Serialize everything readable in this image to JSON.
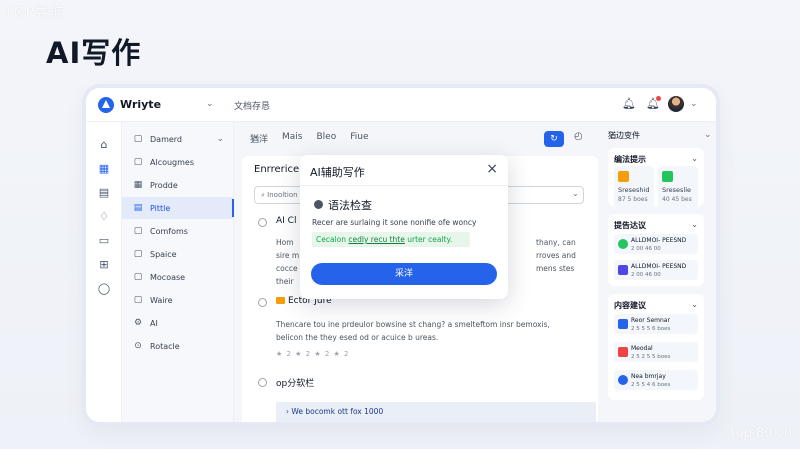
{
  "watermarks": {
    "top_left": "TOP导航",
    "bottom_right": "top 80.cn"
  },
  "hero_title": "AI写作",
  "app": {
    "name": "Wriyte",
    "doc_title": "文档存恳"
  },
  "icon_sidebar": [
    "home-icon",
    "grid-icon",
    "calendar-icon",
    "bell-icon",
    "chat-icon",
    "apps-icon",
    "user-icon"
  ],
  "nav": {
    "items": [
      {
        "icon": "▢",
        "label": "Damerd",
        "chevron": "⌄"
      },
      {
        "icon": "▢",
        "label": "Alcougmes"
      },
      {
        "icon": "▦",
        "label": "Prodde"
      },
      {
        "icon": "▤",
        "label": "Pittle",
        "active": true
      },
      {
        "icon": "▢",
        "label": "Comfoms"
      },
      {
        "icon": "▢",
        "label": "Spaice"
      },
      {
        "icon": "▢",
        "label": "Mocoase"
      },
      {
        "icon": "▢",
        "label": "Waire"
      },
      {
        "icon": "⚙",
        "label": "AI"
      },
      {
        "icon": "⊙",
        "label": "Rotacle"
      }
    ]
  },
  "editor": {
    "tabs": [
      "猶洋",
      "Mais",
      "Bleo",
      "Fiue"
    ],
    "heading": "Enrrerice",
    "search_placeholder": "Inooltion",
    "options": [
      {
        "title": "AI Cl",
        "lines": [
          "Hom",
          "sire m",
          "cocce",
          "their"
        ],
        "right_lines": [
          "thany, can",
          "rroves and",
          "mens stes"
        ]
      },
      {
        "title": "Ector Jure",
        "lines": [
          "Thencare tou ine prdeulor bowsine st chang? a smelteftom insr bemoxis,",
          "belicon the they esed od or acuice b ureas."
        ],
        "stars": "★ 2 ★ 2 ★ 2 ★ 2"
      },
      {
        "title": "op分软栏"
      }
    ],
    "bottom_box": "We bocomk ott fox 1000"
  },
  "right_panel": {
    "title": "猶边变件",
    "section1": {
      "title": "编法提示",
      "tiles": [
        {
          "label": "Sreseshid",
          "sub": "87 5 boes",
          "color": "#f59e0b"
        },
        {
          "label": "Sreseslie",
          "sub": "40 45 bes",
          "color": "#22c55e"
        }
      ]
    },
    "section2": {
      "title": "提告达议",
      "items": [
        {
          "title": "ALLDMOI- PEESND",
          "sub": "2 00 46 00",
          "color": "#22c55e"
        },
        {
          "title": "ALLDMOI- PEESND",
          "sub": "2 00 46 00",
          "color": "#4f46e5"
        }
      ]
    },
    "section3": {
      "title": "内容建议",
      "items": [
        {
          "title": "Reor Semnar",
          "sub": "2 5 5 5 6 boes",
          "color": "#2563eb"
        },
        {
          "title": "Meodal",
          "sub": "2 5 2 5 5 boes",
          "color": "#ef4444"
        },
        {
          "title": "Nea bmrjay",
          "sub": "2 5 5 4 6 boes",
          "color": "#2563eb"
        }
      ]
    }
  },
  "modal": {
    "title": "AI辅助写作",
    "subtitle": "语法检查",
    "text": "Recer are surlaing it sone nonifie ofe woncy",
    "highlight_prefix": "Cecalon ",
    "highlight_underlined": "cedly recu thte",
    "highlight_suffix": " urter cealty.",
    "button": "采洋"
  }
}
